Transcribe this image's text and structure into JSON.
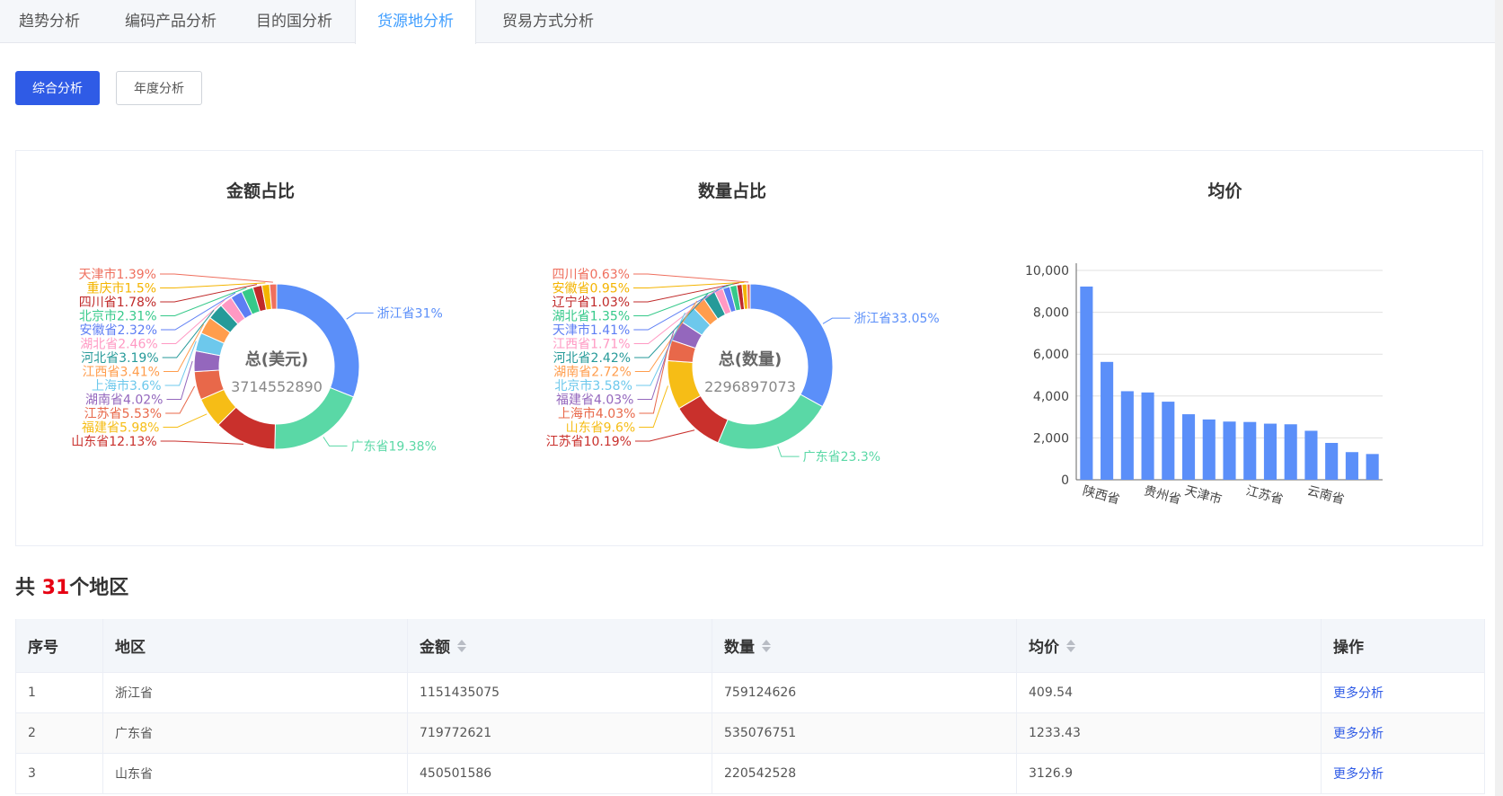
{
  "tabs": [
    {
      "label": "趋势分析",
      "active": false
    },
    {
      "label": "编码产品分析",
      "active": false
    },
    {
      "label": "目的国分析",
      "active": false
    },
    {
      "label": "货源地分析",
      "active": true
    },
    {
      "label": "贸易方式分析",
      "active": false
    }
  ],
  "buttons": {
    "summary": "综合分析",
    "yearly": "年度分析"
  },
  "colors": {
    "accent": "#2f5be6",
    "tab_active": "#409eff",
    "count_highlight": "#e60012",
    "bar": "#5b8ff9"
  },
  "chart_data": [
    {
      "type": "pie",
      "title": "金额占比",
      "center_label": "总(美元)",
      "center_value": "3714552890",
      "slices": [
        {
          "label": "浙江省31%",
          "value": 31,
          "color": "#5b8ff9"
        },
        {
          "label": "广东省19.38%",
          "value": 19.38,
          "color": "#5ad8a6"
        },
        {
          "label": "山东省12.13%",
          "value": 12.13,
          "color": "#c9302c"
        },
        {
          "label": "福建省5.98%",
          "value": 5.98,
          "color": "#f6bd16"
        },
        {
          "label": "江苏省5.53%",
          "value": 5.53,
          "color": "#e8684a"
        },
        {
          "label": "湖南省4.02%",
          "value": 4.02,
          "color": "#9467bd"
        },
        {
          "label": "上海市3.6%",
          "value": 3.6,
          "color": "#6dc8ec"
        },
        {
          "label": "江西省3.41%",
          "value": 3.41,
          "color": "#ff9d4d"
        },
        {
          "label": "河北省3.19%",
          "value": 3.19,
          "color": "#269a99"
        },
        {
          "label": "湖北省2.46%",
          "value": 2.46,
          "color": "#ff99c3"
        },
        {
          "label": "安徽省2.32%",
          "value": 2.32,
          "color": "#5d7ef4"
        },
        {
          "label": "北京市2.31%",
          "value": 2.31,
          "color": "#36c98a"
        },
        {
          "label": "四川省1.78%",
          "value": 1.78,
          "color": "#c02a2a"
        },
        {
          "label": "重庆市1.5%",
          "value": 1.5,
          "color": "#f4b400"
        },
        {
          "label": "天津市1.39%",
          "value": 1.39,
          "color": "#ef6f5e"
        }
      ]
    },
    {
      "type": "pie",
      "title": "数量占比",
      "center_label": "总(数量)",
      "center_value": "2296897073",
      "slices": [
        {
          "label": "浙江省33.05%",
          "value": 33.05,
          "color": "#5b8ff9"
        },
        {
          "label": "广东省23.3%",
          "value": 23.3,
          "color": "#5ad8a6"
        },
        {
          "label": "江苏省10.19%",
          "value": 10.19,
          "color": "#c9302c"
        },
        {
          "label": "山东省9.6%",
          "value": 9.6,
          "color": "#f6bd16"
        },
        {
          "label": "上海市4.03%",
          "value": 4.03,
          "color": "#e8684a"
        },
        {
          "label": "福建省4.03%",
          "value": 4.03,
          "color": "#9467bd"
        },
        {
          "label": "北京市3.58%",
          "value": 3.58,
          "color": "#6dc8ec"
        },
        {
          "label": "湖南省2.72%",
          "value": 2.72,
          "color": "#ff9d4d"
        },
        {
          "label": "河北省2.42%",
          "value": 2.42,
          "color": "#269a99"
        },
        {
          "label": "江西省1.71%",
          "value": 1.71,
          "color": "#ff99c3"
        },
        {
          "label": "天津市1.41%",
          "value": 1.41,
          "color": "#5d7ef4"
        },
        {
          "label": "湖北省1.35%",
          "value": 1.35,
          "color": "#36c98a"
        },
        {
          "label": "辽宁省1.03%",
          "value": 1.03,
          "color": "#c02a2a"
        },
        {
          "label": "安徽省0.95%",
          "value": 0.95,
          "color": "#f4b400"
        },
        {
          "label": "四川省0.63%",
          "value": 0.63,
          "color": "#ef6f5e"
        }
      ]
    },
    {
      "type": "bar",
      "title": "均价",
      "categories": [
        "陕西省",
        "",
        "",
        "贵州省",
        "",
        "天津市",
        "",
        "",
        "江苏省",
        "",
        "",
        "云南省",
        "",
        "",
        ""
      ],
      "values": [
        9230,
        5630,
        4230,
        4170,
        3730,
        3130,
        2880,
        2780,
        2760,
        2680,
        2650,
        2340,
        1760,
        1320,
        1230
      ],
      "ylim": [
        0,
        10000
      ],
      "yticks": [
        "0",
        "2,000",
        "4,000",
        "6,000",
        "8,000",
        "10,000"
      ],
      "grid": true
    }
  ],
  "summary": {
    "prefix": "共 ",
    "count": "31",
    "suffix": "个地区"
  },
  "table": {
    "headers": [
      "序号",
      "地区",
      "金额",
      "数量",
      "均价",
      "操作"
    ],
    "rows": [
      {
        "index": "1",
        "region": "浙江省",
        "amount": "1151435075",
        "quantity": "759124626",
        "avg": "409.54",
        "action": "更多分析"
      },
      {
        "index": "2",
        "region": "广东省",
        "amount": "719772621",
        "quantity": "535076751",
        "avg": "1233.43",
        "action": "更多分析"
      },
      {
        "index": "3",
        "region": "山东省",
        "amount": "450501586",
        "quantity": "220542528",
        "avg": "3126.9",
        "action": "更多分析"
      }
    ]
  }
}
